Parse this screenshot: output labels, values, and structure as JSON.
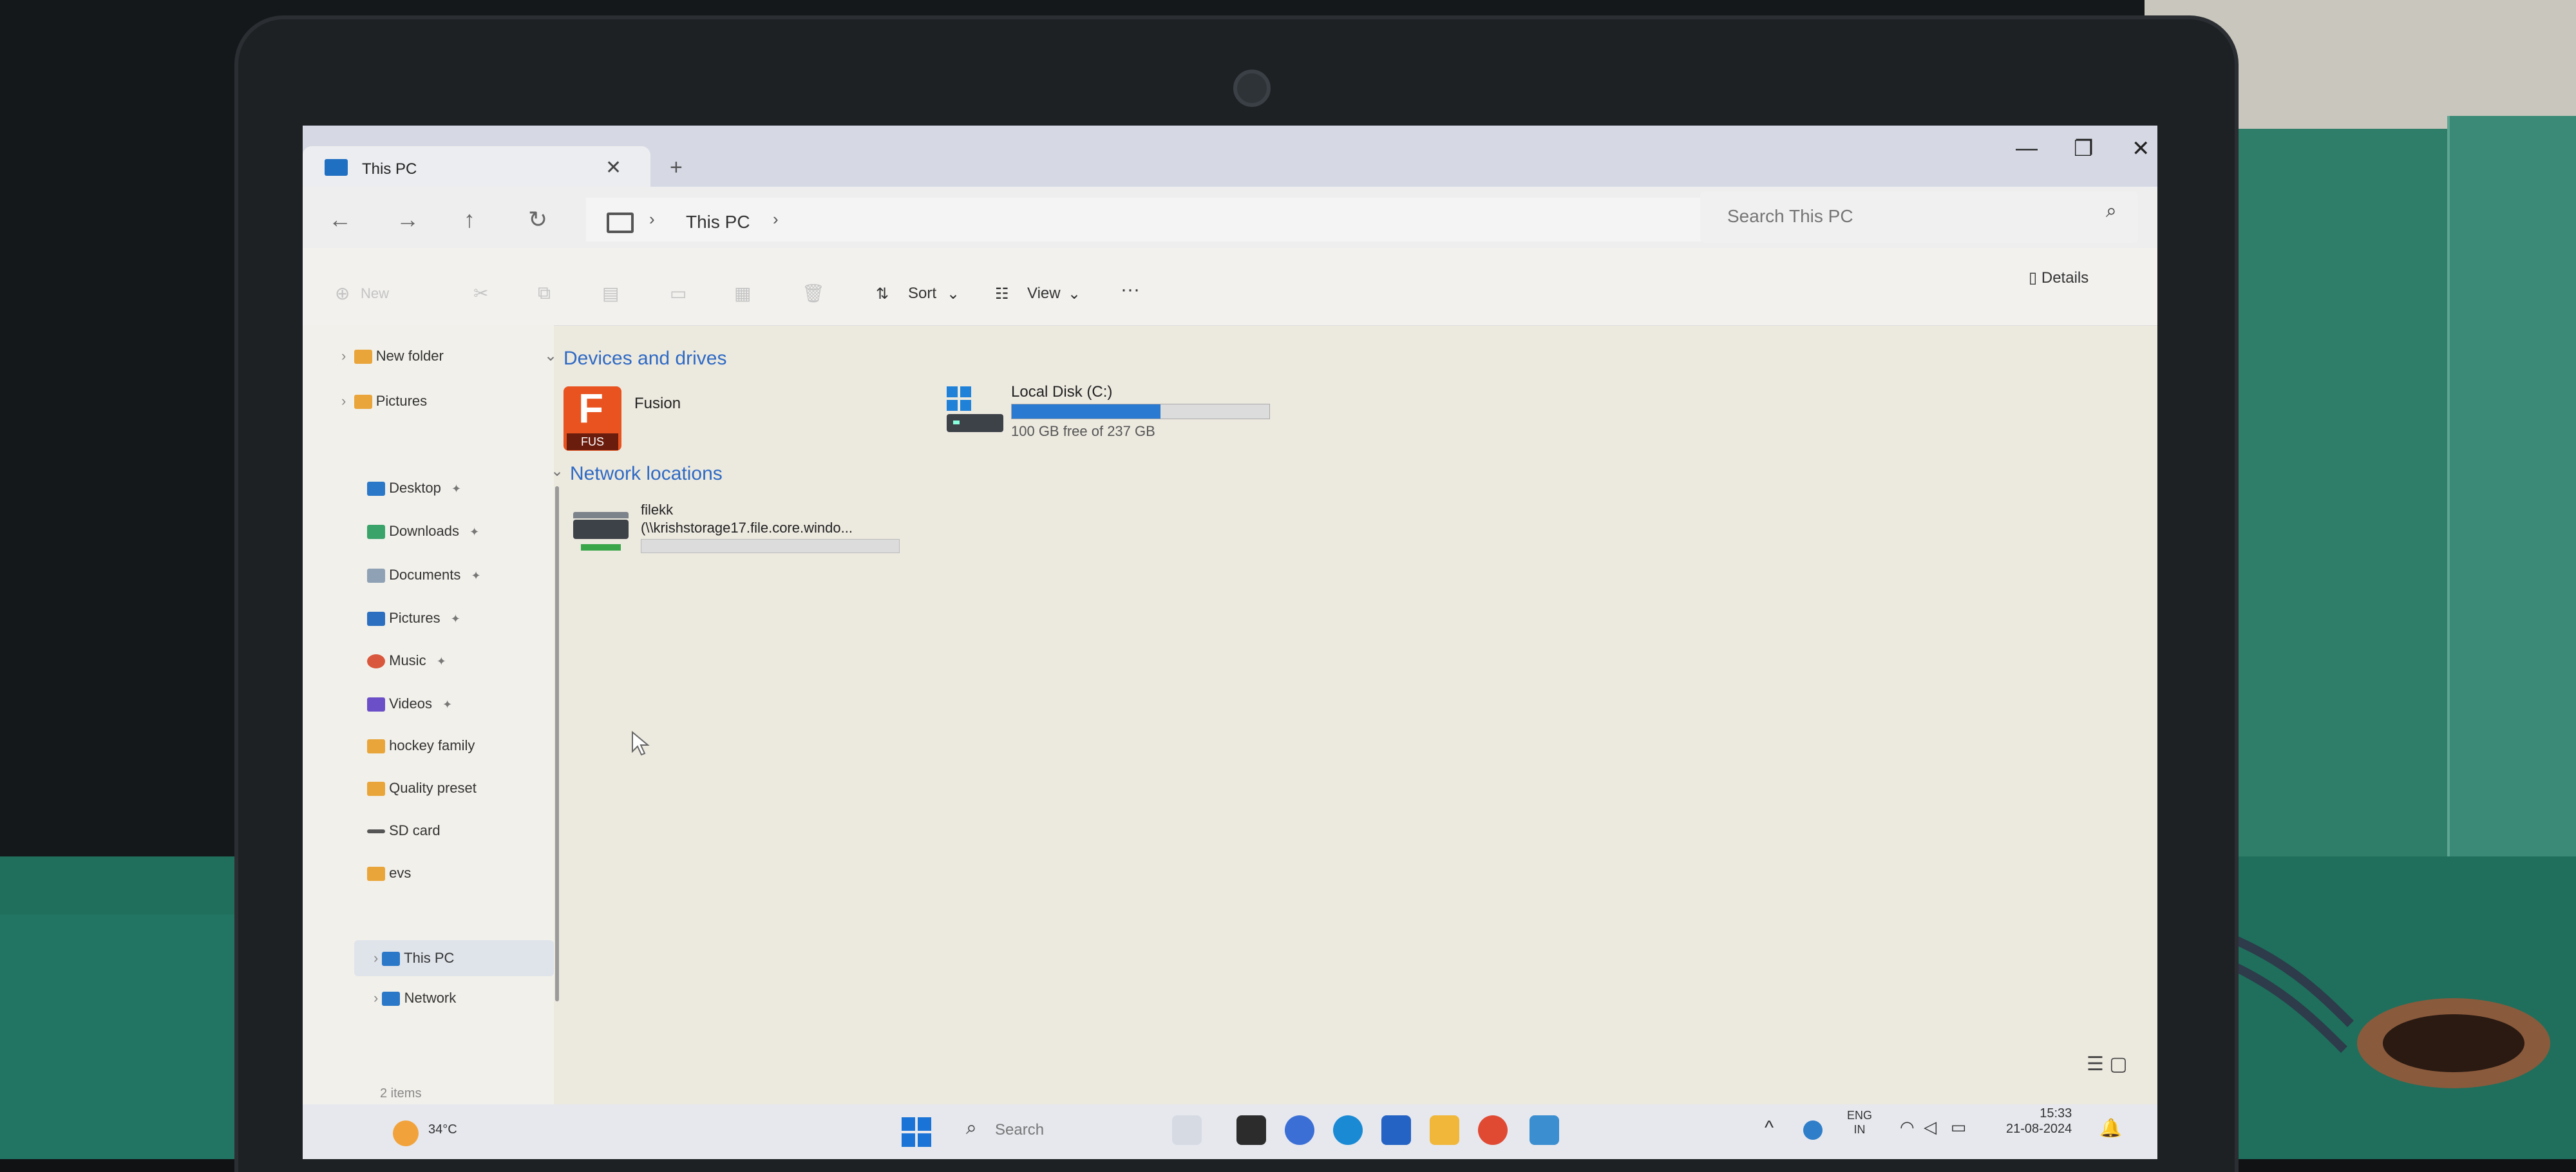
{
  "window": {
    "tab_title": "This PC",
    "tab_close": "✕",
    "tab_add": "+",
    "minimize": "—",
    "maximize": "❐",
    "close": "✕"
  },
  "nav": {
    "back": "←",
    "forward": "→",
    "up": "↑",
    "refresh": "↻",
    "breadcrumb": [
      "This PC"
    ],
    "breadcrumb_sep": "›"
  },
  "search": {
    "placeholder": "Search This PC"
  },
  "toolbar": {
    "new_label": "New",
    "sort_label": "Sort",
    "view_label": "View",
    "more_label": "···",
    "details_label": "Details"
  },
  "sidebar": {
    "tree": [
      {
        "label": "New folder"
      },
      {
        "label": "Pictures"
      }
    ],
    "quick_access": [
      {
        "label": "Desktop",
        "pinned": true
      },
      {
        "label": "Downloads",
        "pinned": true
      },
      {
        "label": "Documents",
        "pinned": true
      },
      {
        "label": "Pictures",
        "pinned": true
      },
      {
        "label": "Music",
        "pinned": true
      },
      {
        "label": "Videos",
        "pinned": true
      },
      {
        "label": "hockey family",
        "pinned": false
      },
      {
        "label": "Quality preset",
        "pinned": false
      },
      {
        "label": "SD card",
        "pinned": false
      },
      {
        "label": "evs",
        "pinned": false
      }
    ],
    "locations": [
      {
        "label": "This PC",
        "selected": true
      },
      {
        "label": "Network",
        "selected": false
      }
    ],
    "status": "2 items"
  },
  "content": {
    "devices_title": "Devices and drives",
    "fusion": {
      "label": "Fusion",
      "icon_letter": "F",
      "icon_tag": "FUS"
    },
    "local_disk": {
      "label": "Local Disk (C:)",
      "free_text": "100 GB free of 237 GB",
      "used_fraction": 0.578
    },
    "network_title": "Network locations",
    "network_item": {
      "name": "filekk",
      "path": "(\\\\krishstorage17.file.core.windo..."
    }
  },
  "taskbar": {
    "weather_temp": "34°C",
    "search_label": "Search",
    "lang": "ENG",
    "region": "IN",
    "time": "15:33",
    "date": "21-08-2024"
  },
  "colors": {
    "accent": "#2a7ad2",
    "group_title": "#2f6ac4",
    "fusion": "#e8531f"
  }
}
